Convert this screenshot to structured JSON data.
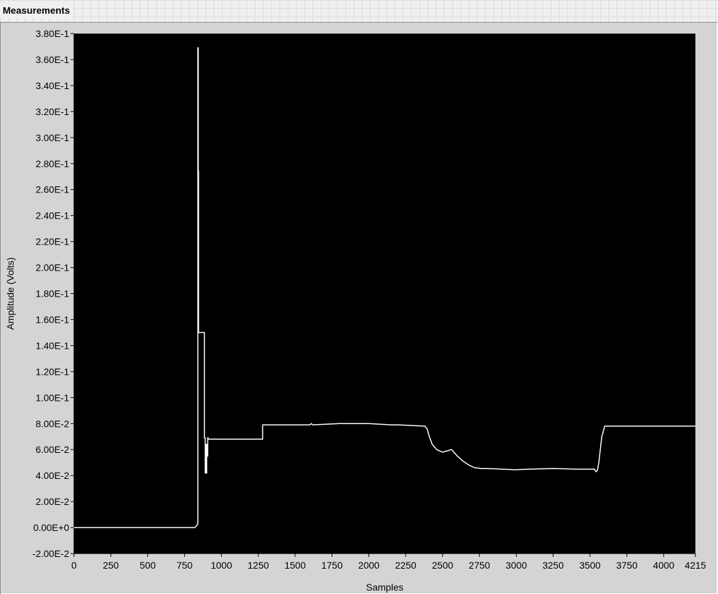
{
  "caption": "Measurements",
  "chart_data": {
    "type": "line",
    "title": "",
    "xlabel": "Samples",
    "ylabel": "Amplitude (Volts)",
    "xlim": [
      0,
      4215
    ],
    "ylim": [
      -0.02,
      0.38
    ],
    "x_ticks": [
      0,
      250,
      500,
      750,
      1000,
      1250,
      1500,
      1750,
      2000,
      2250,
      2500,
      2750,
      3000,
      3250,
      3500,
      3750,
      4000,
      4215
    ],
    "x_tick_labels": [
      "0",
      "250",
      "500",
      "750",
      "1000",
      "1250",
      "1500",
      "1750",
      "2000",
      "2250",
      "2500",
      "2750",
      "3000",
      "3250",
      "3500",
      "3750",
      "4000",
      "4215"
    ],
    "y_ticks": [
      -0.02,
      0,
      0.02,
      0.04,
      0.06,
      0.08,
      0.1,
      0.12,
      0.14,
      0.16,
      0.18,
      0.2,
      0.22,
      0.24,
      0.26,
      0.28,
      0.3,
      0.32,
      0.34,
      0.36,
      0.38
    ],
    "y_tick_labels": [
      "-2.00E-2",
      "0.00E+0",
      "2.00E-2",
      "4.00E-2",
      "6.00E-2",
      "8.00E-2",
      "1.00E-1",
      "1.20E-1",
      "1.40E-1",
      "1.60E-1",
      "1.80E-1",
      "2.00E-1",
      "2.20E-1",
      "2.40E-1",
      "2.60E-1",
      "2.80E-1",
      "3.00E-1",
      "3.20E-1",
      "3.40E-1",
      "3.60E-1",
      "3.80E-1"
    ],
    "grid": false,
    "plot_background": "#000000",
    "series": [
      {
        "color": "#ffffff",
        "x": [
          0,
          820,
          835,
          840,
          840,
          843,
          843,
          845,
          845,
          848,
          848,
          885,
          885,
          890,
          890,
          893,
          893,
          896,
          896,
          900,
          900,
          904,
          904,
          907,
          907,
          910,
          910,
          1280,
          1280,
          1290,
          1450,
          1600,
          1610,
          1620,
          1800,
          2000,
          2150,
          2200,
          2380,
          2395,
          2410,
          2430,
          2460,
          2500,
          2530,
          2560,
          2570,
          2600,
          2640,
          2680,
          2720,
          2760,
          2800,
          2900,
          2980,
          3000,
          3100,
          3250,
          3400,
          3480,
          3530,
          3540,
          3550,
          3560,
          3570,
          3580,
          3600,
          3620,
          4215
        ],
        "y": [
          0,
          0,
          0.002,
          0.003,
          0.369,
          0.369,
          0.274,
          0.274,
          0.15,
          0.15,
          0.15,
          0.15,
          0.069,
          0.069,
          0.042,
          0.042,
          0.064,
          0.064,
          0.042,
          0.042,
          0.064,
          0.064,
          0.055,
          0.055,
          0.069,
          0.069,
          0.068,
          0.068,
          0.079,
          0.079,
          0.079,
          0.079,
          0.08,
          0.079,
          0.08,
          0.08,
          0.079,
          0.079,
          0.078,
          0.076,
          0.07,
          0.064,
          0.06,
          0.058,
          0.059,
          0.06,
          0.059,
          0.055,
          0.051,
          0.048,
          0.046,
          0.0455,
          0.0455,
          0.045,
          0.0445,
          0.0445,
          0.045,
          0.0455,
          0.045,
          0.045,
          0.045,
          0.043,
          0.044,
          0.05,
          0.06,
          0.07,
          0.078,
          0.078,
          0.078
        ]
      }
    ]
  }
}
